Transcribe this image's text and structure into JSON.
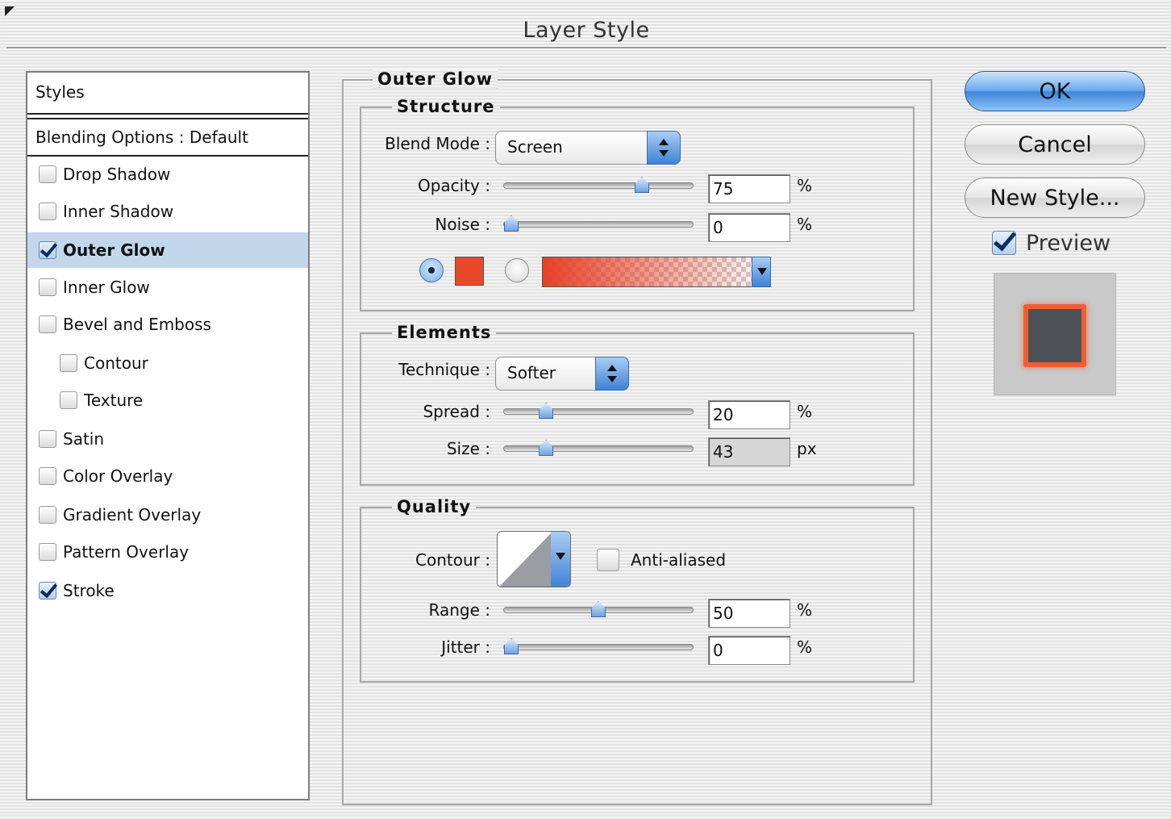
{
  "window": {
    "title": "Layer Style"
  },
  "styles_panel": {
    "header": "Styles",
    "blending_options": "Blending Options : Default",
    "items": [
      {
        "label": "Drop Shadow",
        "checked": false
      },
      {
        "label": "Inner Shadow",
        "checked": false
      },
      {
        "label": "Outer Glow",
        "checked": true
      },
      {
        "label": "Inner Glow",
        "checked": false
      },
      {
        "label": "Bevel and Emboss",
        "checked": false
      },
      {
        "label": "Contour",
        "checked": false
      },
      {
        "label": "Texture",
        "checked": false
      },
      {
        "label": "Satin",
        "checked": false
      },
      {
        "label": "Color Overlay",
        "checked": false
      },
      {
        "label": "Gradient Overlay",
        "checked": false
      },
      {
        "label": "Pattern Overlay",
        "checked": false
      },
      {
        "label": "Stroke",
        "checked": true
      }
    ]
  },
  "outer_glow": {
    "title": "Outer Glow",
    "structure": {
      "title": "Structure",
      "blend_mode_label": "Blend Mode :",
      "blend_mode_value": "Screen",
      "opacity_label": "Opacity :",
      "opacity_value": "75",
      "opacity_unit": "%",
      "opacity_fraction": 0.75,
      "noise_label": "Noise :",
      "noise_value": "0",
      "noise_unit": "%",
      "noise_fraction": 0.0,
      "color_hex": "#e8472a"
    },
    "elements": {
      "title": "Elements",
      "technique_label": "Technique :",
      "technique_value": "Softer",
      "spread_label": "Spread :",
      "spread_value": "20",
      "spread_unit": "%",
      "spread_fraction": 0.2,
      "size_label": "Size :",
      "size_value": "43",
      "size_unit": "px",
      "size_fraction": 0.2
    },
    "quality": {
      "title": "Quality",
      "contour_label": "Contour :",
      "anti_aliased_label": "Anti-aliased",
      "range_label": "Range :",
      "range_value": "50",
      "range_unit": "%",
      "range_fraction": 0.5,
      "jitter_label": "Jitter :",
      "jitter_value": "0",
      "jitter_unit": "%",
      "jitter_fraction": 0.0
    }
  },
  "buttons": {
    "ok": "OK",
    "cancel": "Cancel",
    "new_style": "New Style...",
    "preview_label": "Preview"
  },
  "colors": {
    "accent": "#3f86db",
    "selection": "#c3d7ec",
    "stroke_color": "#ef5f33"
  }
}
